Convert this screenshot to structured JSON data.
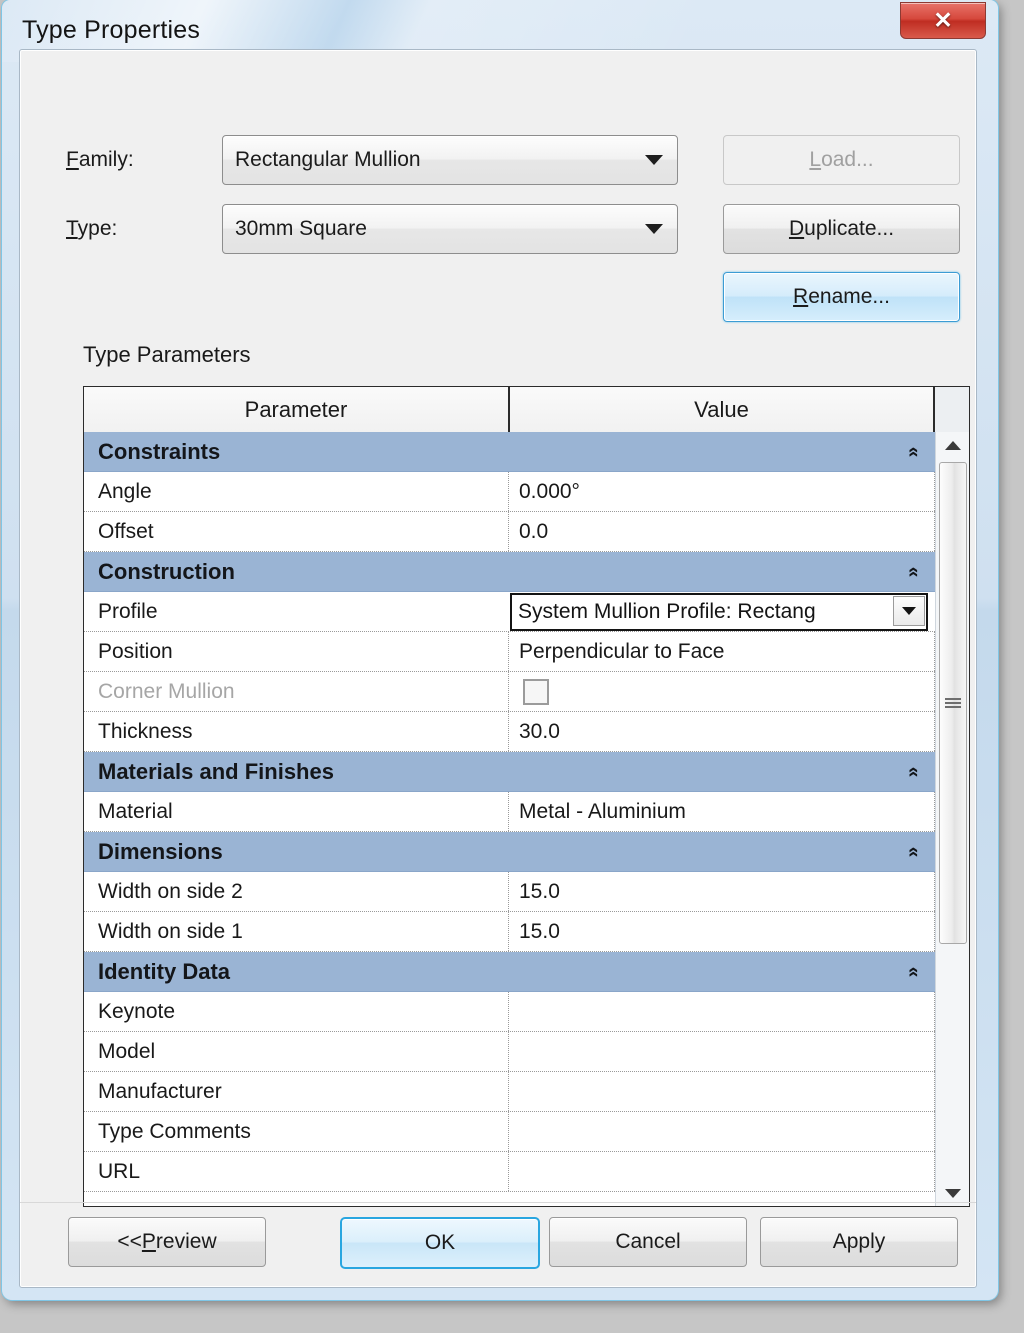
{
  "window": {
    "title": "Type Properties",
    "close_label": "✕"
  },
  "form": {
    "family_label_pre": "F",
    "family_label_post": "amily:",
    "family_value": "Rectangular Mullion",
    "type_label_pre": "T",
    "type_label_post": "ype:",
    "type_value": "30mm Square",
    "load_pre": "L",
    "load_post": "oad...",
    "duplicate_pre": "D",
    "duplicate_post": "uplicate...",
    "rename_pre": "R",
    "rename_post": "ename..."
  },
  "table": {
    "caption": "Type Parameters",
    "col_parameter": "Parameter",
    "col_value": "Value",
    "collapse_icon": "«",
    "rows": [
      {
        "kind": "group",
        "name": "Constraints"
      },
      {
        "kind": "item",
        "name": "Angle",
        "value": "0.000°"
      },
      {
        "kind": "item",
        "name": "Offset",
        "value": "0.0"
      },
      {
        "kind": "group",
        "name": "Construction"
      },
      {
        "kind": "combo",
        "name": "Profile",
        "value": "System Mullion Profile: Rectang"
      },
      {
        "kind": "item",
        "name": "Position",
        "value": "Perpendicular to Face"
      },
      {
        "kind": "checkbox",
        "name": "Corner Mullion",
        "value": "",
        "disabled": true,
        "checked": false
      },
      {
        "kind": "item",
        "name": "Thickness",
        "value": "30.0"
      },
      {
        "kind": "group",
        "name": "Materials and Finishes"
      },
      {
        "kind": "item",
        "name": "Material",
        "value": "Metal - Aluminium"
      },
      {
        "kind": "group",
        "name": "Dimensions"
      },
      {
        "kind": "item",
        "name": "Width on side 2",
        "value": "15.0"
      },
      {
        "kind": "item",
        "name": "Width on side 1",
        "value": "15.0"
      },
      {
        "kind": "group",
        "name": "Identity Data"
      },
      {
        "kind": "item",
        "name": "Keynote",
        "value": ""
      },
      {
        "kind": "item",
        "name": "Model",
        "value": ""
      },
      {
        "kind": "item",
        "name": "Manufacturer",
        "value": ""
      },
      {
        "kind": "item",
        "name": "Type Comments",
        "value": ""
      },
      {
        "kind": "item",
        "name": "URL",
        "value": ""
      }
    ]
  },
  "footer": {
    "preview_pre": "<< ",
    "preview_mid": "P",
    "preview_post": "review",
    "ok": "OK",
    "cancel": "Cancel",
    "apply": "Apply"
  },
  "colors": {
    "group_header": "#9ab4d4",
    "accent_focus": "#29a6e0",
    "close_red": "#d6483c",
    "glass": "#cfe0f0"
  }
}
